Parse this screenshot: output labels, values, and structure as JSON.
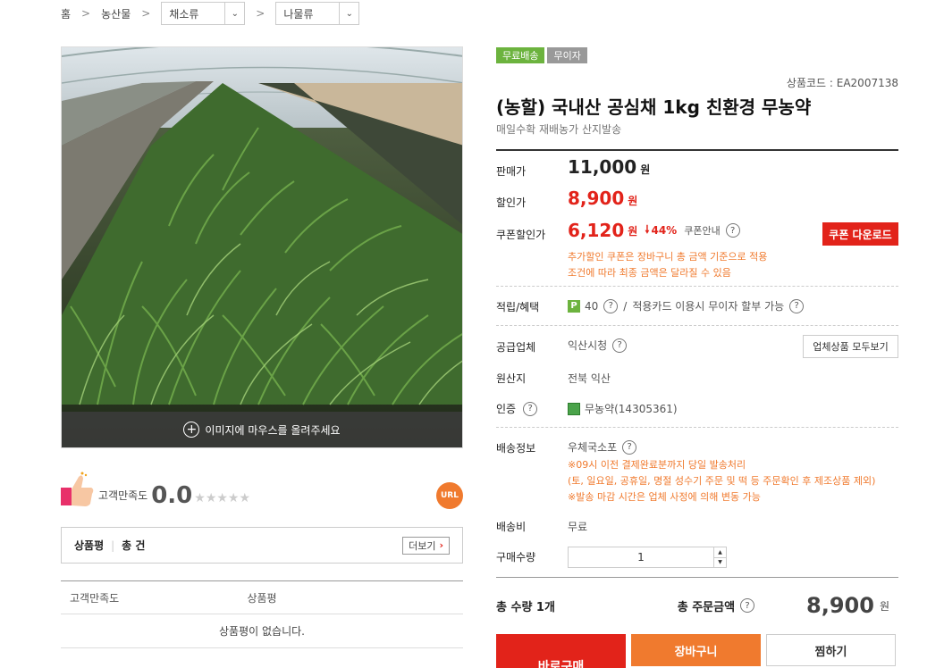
{
  "breadcrumb": {
    "home": "홈",
    "level1": "농산물",
    "level2": "채소류",
    "level3": "나물류",
    "sep": ">"
  },
  "image": {
    "hover_text": "이미지에 마우스를 올려주세요"
  },
  "satisfaction": {
    "label": "고객만족도",
    "score": "0.0",
    "stars": "★★★★★",
    "rating_fraction": 0
  },
  "url_button": "URL",
  "reviews": {
    "title": "상품평",
    "count_label": "총 건",
    "more_label": "더보기",
    "col_satisfaction": "고객만족도",
    "col_review": "상품평",
    "empty": "상품평이 없습니다."
  },
  "badges": [
    "무료배송",
    "무이자"
  ],
  "product": {
    "code": "상품코드 : EA2007138",
    "title": "(농할) 국내산 공심채 1kg 친환경 무농약",
    "subtitle": "매일수확 재배농가 산지발송"
  },
  "prices": {
    "sale_label": "판매가",
    "sale_price": "11,000",
    "discount_label": "할인가",
    "discount_price": "8,900",
    "coupon_label": "쿠폰할인가",
    "coupon_price": "6,120",
    "unit": "원",
    "coupon_percent": "44%",
    "coupon_info": "쿠폰안내",
    "coupon_button": "쿠폰 다운로드",
    "note1": "추가할인 쿠폰은 장바구니 총 금액 기준으로 적용",
    "note2": "조건에 따라 최종 금액은 달라질 수 있음"
  },
  "benefit": {
    "label": "적립/혜택",
    "points": "40",
    "slash": "/",
    "card_text": "적용카드 이용시 무이자 할부 가능"
  },
  "vendor": {
    "label": "공급업체",
    "name": "익산시청",
    "button": "업체상품 모두보기"
  },
  "origin": {
    "label": "원산지",
    "value": "전북 익산"
  },
  "cert": {
    "label": "인증",
    "value": "무농약(14305361)"
  },
  "shipping": {
    "label": "배송정보",
    "method": "우체국소포",
    "note1": "※09시 이전 결제완료분까지 당일 발송처리",
    "note2": "(토, 일요일, 공휴일, 명절 성수기 주문 및 떡 등 주문확인 후 제조상품 제외)",
    "note3": "※발송 마감 시간은 업체 사정에 의해 변동 가능"
  },
  "fee": {
    "label": "배송비",
    "value": "무료"
  },
  "quantity": {
    "label": "구매수량",
    "value": "1"
  },
  "total": {
    "qty_label": "총 수량 1개",
    "amount_label": "총 주문금액",
    "amount": "8,900",
    "unit": "원"
  },
  "buttons": {
    "buy": "바로구매",
    "cart": "장바구니",
    "wish": "찜하기"
  },
  "colors": {
    "accent_red": "#e2231a",
    "accent_orange": "#f07a2e",
    "badge_green": "#6cb33e"
  }
}
